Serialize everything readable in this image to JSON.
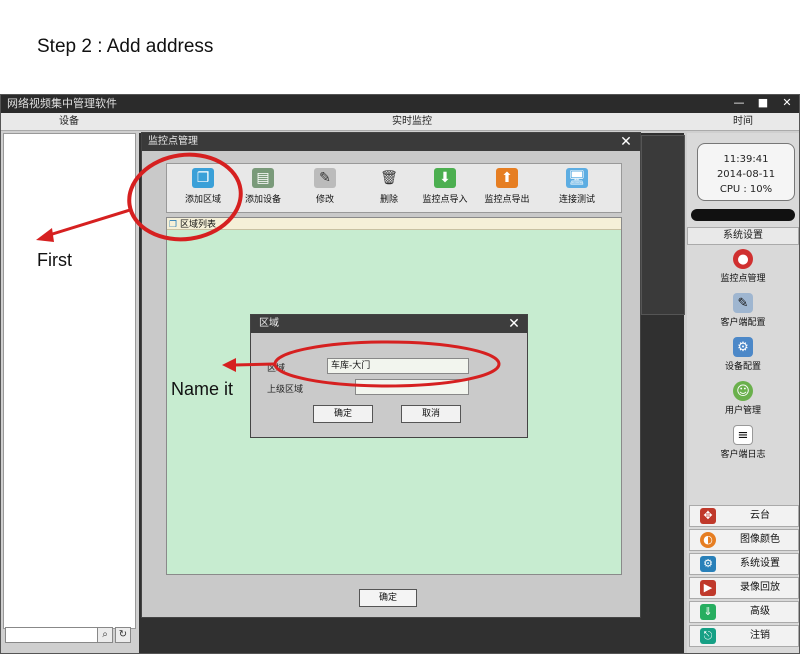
{
  "step_title": "Step 2 : Add address",
  "app": {
    "title": "网络视频集中管理软件",
    "window_controls": [
      "—",
      "■",
      "✕"
    ],
    "columns": {
      "devices": "设备",
      "live": "实时监控",
      "time": "时间"
    },
    "clock": {
      "time": "11:39:41",
      "date": "2014-08-11",
      "cpu": "CPU : 10%"
    },
    "system_settings_header": "系统设置",
    "side_items": [
      {
        "label": "监控点管理",
        "icon": "record-icon"
      },
      {
        "label": "客户端配置",
        "icon": "client-config-icon"
      },
      {
        "label": "设备配置",
        "icon": "device-config-icon"
      },
      {
        "label": "用户管理",
        "icon": "users-icon"
      },
      {
        "label": "客户端日志",
        "icon": "document-icon"
      }
    ],
    "bottom_items": [
      {
        "label": "云台",
        "icon": "ptz-icon"
      },
      {
        "label": "图像颜色",
        "icon": "color-icon"
      },
      {
        "label": "系统设置",
        "icon": "settings-icon"
      },
      {
        "label": "录像回放",
        "icon": "playback-icon"
      },
      {
        "label": "高级",
        "icon": "advanced-icon"
      },
      {
        "label": "注销",
        "icon": "logout-icon"
      }
    ],
    "search_button_icons": [
      "search-icon",
      "refresh-icon"
    ]
  },
  "monitor_dialog": {
    "title": "监控点管理",
    "toolbar": [
      {
        "label": "添加区域",
        "icon": "add-area-icon"
      },
      {
        "label": "添加设备",
        "icon": "add-device-icon"
      },
      {
        "label": "修改",
        "icon": "edit-icon"
      },
      {
        "label": "删除",
        "icon": "trash-icon"
      },
      {
        "label": "监控点导入",
        "icon": "import-icon"
      },
      {
        "label": "监控点导出",
        "icon": "export-icon"
      },
      {
        "label": "连接测试",
        "icon": "connection-test-icon"
      }
    ],
    "tree_root": "区域列表",
    "ok_label": "确定"
  },
  "area_dialog": {
    "title": "区域",
    "area_label": "区域",
    "area_value": "车库-大门",
    "parent_label": "上级区域",
    "parent_value": "",
    "ok_label": "确定",
    "cancel_label": "取消"
  },
  "annotations": {
    "first": "First",
    "name_it": "Name it",
    "color": "#d62020"
  }
}
